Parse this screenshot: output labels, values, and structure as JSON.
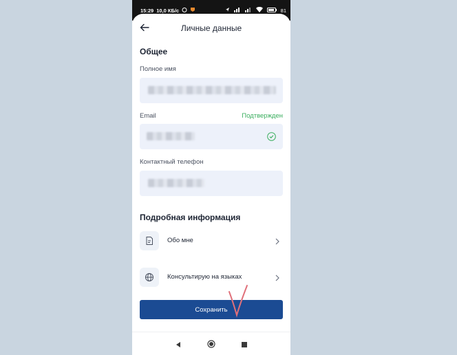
{
  "statusbar": {
    "time": "15:29",
    "speed": "10,0 КБ/с",
    "battery": "81"
  },
  "header": {
    "title": "Личные данные"
  },
  "general": {
    "section_title": "Общее",
    "full_name_label": "Полное имя",
    "email_label": "Email",
    "email_status": "Подтвержден",
    "phone_label": "Контактный телефон"
  },
  "details": {
    "section_title": "Подробная информация",
    "items": [
      {
        "label": "Обо мне",
        "icon": "document-icon"
      },
      {
        "label": "Консультирую на языках",
        "icon": "globe-icon"
      }
    ]
  },
  "actions": {
    "save_label": "Сохранить"
  },
  "colors": {
    "accent": "#1b4b93",
    "verified": "#3aae5e",
    "field_bg": "#edf1fa",
    "annotation": "#e0707a"
  }
}
